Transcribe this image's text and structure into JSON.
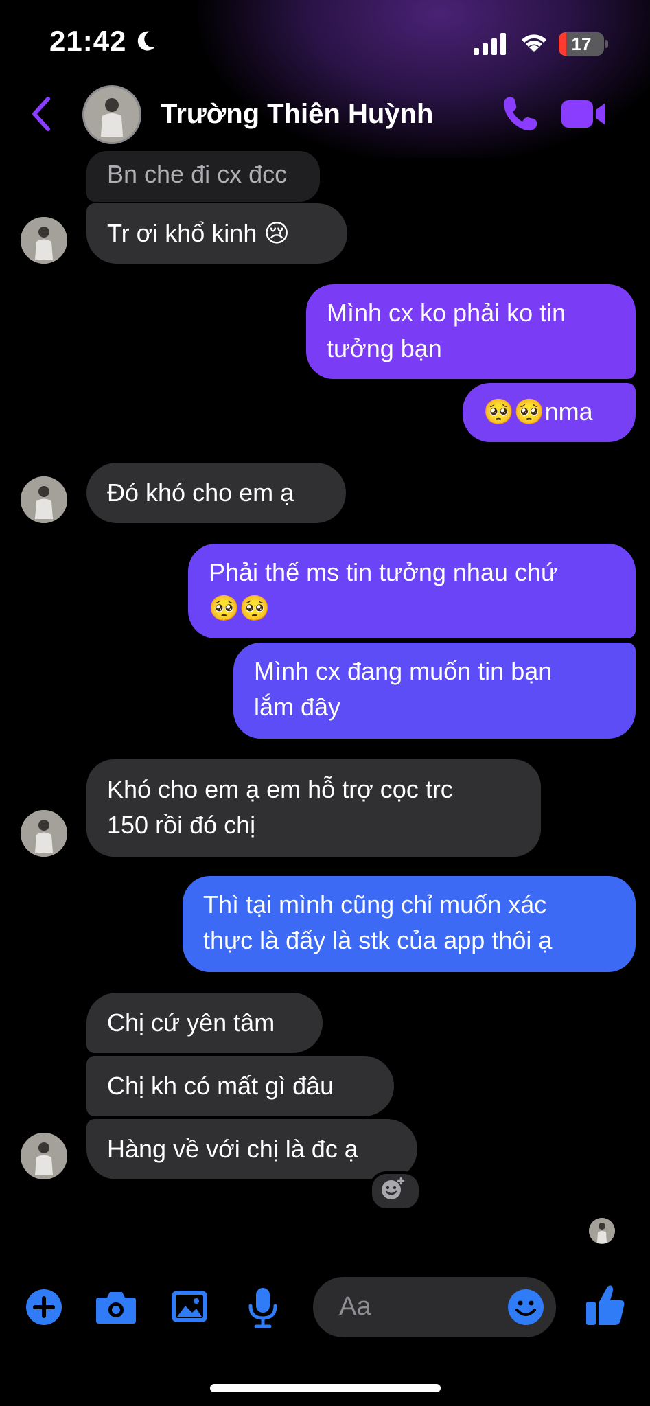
{
  "status": {
    "time": "21:42",
    "battery": "17"
  },
  "header": {
    "contact_name": "Trường Thiên Huỳnh"
  },
  "messages": [
    {
      "side": "in",
      "text": "Bn che đi cx đcc"
    },
    {
      "side": "in",
      "text": "Tr ơi khổ kinh 😢"
    },
    {
      "side": "out",
      "lines": [
        "Mình cx ko phải ko tin",
        "tưởng bạn"
      ]
    },
    {
      "side": "out",
      "text": "🥺🥺nma"
    },
    {
      "side": "in",
      "text": "Đó khó cho em ạ"
    },
    {
      "side": "out",
      "lines": [
        "Phải thế ms tin tưởng nhau chứ",
        "🥺🥺"
      ]
    },
    {
      "side": "out",
      "lines": [
        "Mình cx đang muốn tin bạn",
        "lắm đây"
      ]
    },
    {
      "side": "in",
      "lines": [
        "Khó cho em ạ em hỗ trợ cọc trc",
        "150 rồi đó chị"
      ]
    },
    {
      "side": "out",
      "lines": [
        "Thì tại mình cũng chỉ muốn xác",
        "thực là đấy là stk của app thôi ạ"
      ]
    },
    {
      "side": "in",
      "text": "Chị cứ yên tâm"
    },
    {
      "side": "in",
      "text": "Chị kh có mất gì đâu"
    },
    {
      "side": "in",
      "text": "Hàng về với chị là đc ạ"
    }
  ],
  "composer": {
    "placeholder": "Aa"
  },
  "colors": {
    "accent": "#8b3dff",
    "incoming_bubble": "#303033",
    "outgoing_top": "#7b3cf6",
    "outgoing_bottom": "#3b6ff5",
    "composer_icon": "#2f7cf6"
  }
}
